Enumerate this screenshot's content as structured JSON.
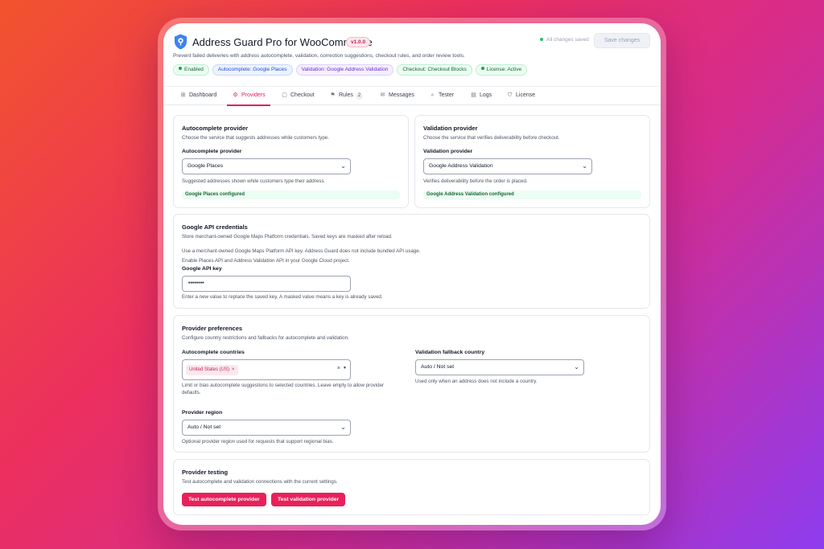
{
  "app": {
    "title": "Address Guard Pro for WooCommerce",
    "version": "v1.0.0",
    "saved_status": "All changes saved",
    "save_label": "Save changes",
    "subtitle": "Prevent failed deliveries with address autocomplete, validation, correction suggestions, checkout rules, and order review tools."
  },
  "badges": [
    {
      "label": "Enabled"
    },
    {
      "label": "Autocomplete: Google Places"
    },
    {
      "label": "Validation: Google Address Validation"
    },
    {
      "label": "Checkout: Checkout Blocks"
    },
    {
      "label": "License: Active"
    }
  ],
  "tabs": [
    {
      "label": "Dashboard",
      "icon": "grid-icon"
    },
    {
      "label": "Providers",
      "icon": "gear-icon",
      "active": true
    },
    {
      "label": "Checkout",
      "icon": "cart-icon"
    },
    {
      "label": "Rules",
      "icon": "flag-icon",
      "count": "2"
    },
    {
      "label": "Messages",
      "icon": "mail-icon"
    },
    {
      "label": "Tester",
      "icon": "search-icon"
    },
    {
      "label": "Logs",
      "icon": "file-icon"
    },
    {
      "label": "License",
      "icon": "shield-icon"
    }
  ],
  "autocomplete_card": {
    "title": "Autocomplete provider",
    "desc": "Choose the service that suggests addresses while customers type.",
    "field_label": "Autocomplete provider",
    "selected": "Google Places",
    "hint": "Suggested addresses shown while customers type their address.",
    "status": "Google Places configured"
  },
  "validation_card": {
    "title": "Validation provider",
    "desc": "Choose the service that verifies deliverability before checkout.",
    "field_label": "Validation provider",
    "selected": "Google Address Validation",
    "hint": "Verifies deliverability before the order is placed.",
    "status": "Google Address Validation configured"
  },
  "api_card": {
    "title": "Google API credentials",
    "desc": "Store merchant-owned Google Maps Platform credentials. Saved keys are masked after reload.",
    "note1": "Use a merchant-owned Google Maps Platform API key. Address Guard does not include bundled API usage.",
    "note2": "Enable Places API and Address Validation API in your Google Cloud project.",
    "field_label": "Google API key",
    "value": "••••••••",
    "hint": "Enter a new value to replace the saved key. A masked value means a key is already saved."
  },
  "prefs_card": {
    "title": "Provider preferences",
    "desc": "Configure country restrictions and fallbacks for autocomplete and validation.",
    "countries_label": "Autocomplete countries",
    "country_chip": "United States (US)",
    "countries_hint_1": "Limit or bias autocomplete suggestions to selected countries. Leave empty to allow provider",
    "countries_hint_2": "defaults.",
    "fallback_label": "Validation fallback country",
    "fallback_selected": "Auto / Not set",
    "fallback_hint": "Used only when an address does not include a country.",
    "region_label": "Provider region",
    "region_selected": "Auto / Not set",
    "region_hint": "Optional provider region used for requests that support regional bias."
  },
  "testing_card": {
    "title": "Provider testing",
    "desc": "Test autocomplete and validation connections with the current settings.",
    "btn_autocomplete": "Test autocomplete provider",
    "btn_validation": "Test validation provider"
  }
}
